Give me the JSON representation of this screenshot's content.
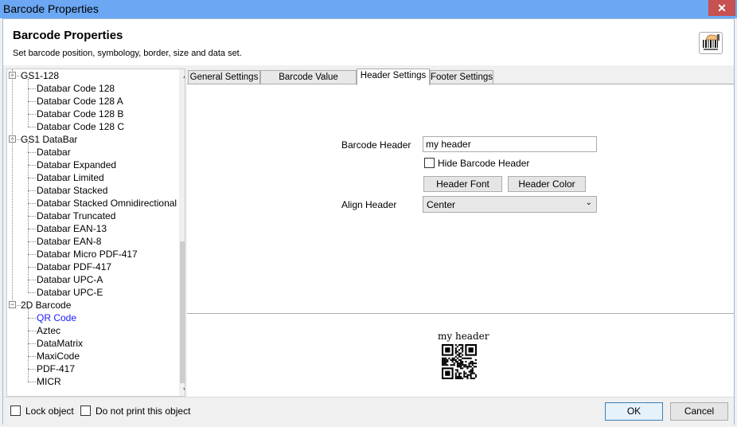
{
  "window": {
    "title": "Barcode Properties",
    "close": "✕"
  },
  "header": {
    "title": "Barcode Properties",
    "subtitle": "Set barcode position, symbology, border, size and data set."
  },
  "tree": [
    {
      "label": "GS1-128",
      "level": 0,
      "expanded": true
    },
    {
      "label": "Databar Code 128",
      "level": 1
    },
    {
      "label": "Databar Code 128 A",
      "level": 1
    },
    {
      "label": "Databar Code 128 B",
      "level": 1
    },
    {
      "label": "Databar Code 128 C",
      "level": 1
    },
    {
      "label": "GS1 DataBar",
      "level": 0,
      "expanded": true
    },
    {
      "label": "Databar",
      "level": 1
    },
    {
      "label": "Databar Expanded",
      "level": 1
    },
    {
      "label": "Databar Limited",
      "level": 1
    },
    {
      "label": "Databar Stacked",
      "level": 1
    },
    {
      "label": "Databar Stacked Omnidirectional",
      "level": 1
    },
    {
      "label": "Databar Truncated",
      "level": 1
    },
    {
      "label": "Databar EAN-13",
      "level": 1
    },
    {
      "label": "Databar EAN-8",
      "level": 1
    },
    {
      "label": "Databar Micro PDF-417",
      "level": 1
    },
    {
      "label": "Databar PDF-417",
      "level": 1
    },
    {
      "label": "Databar UPC-A",
      "level": 1
    },
    {
      "label": "Databar UPC-E",
      "level": 1
    },
    {
      "label": "2D Barcode",
      "level": 0,
      "expanded": true
    },
    {
      "label": "QR Code",
      "level": 1,
      "selected": true
    },
    {
      "label": "Aztec",
      "level": 1
    },
    {
      "label": "DataMatrix",
      "level": 1
    },
    {
      "label": "MaxiCode",
      "level": 1
    },
    {
      "label": "PDF-417",
      "level": 1
    },
    {
      "label": "MICR",
      "level": 1
    }
  ],
  "tabs": [
    "General Settings",
    "Barcode Value Settings",
    "Header Settings",
    "Footer Settings"
  ],
  "active_tab": 2,
  "form": {
    "barcode_header_label": "Barcode Header",
    "barcode_header_value": "my header",
    "hide_header_label": "Hide Barcode Header",
    "hide_header_checked": false,
    "header_font_button": "Header Font",
    "header_color_button": "Header Color",
    "align_header_label": "Align Header",
    "align_header_value": "Center"
  },
  "preview": {
    "header_text": "my header"
  },
  "footer": {
    "lock_label": "Lock object",
    "no_print_label": "Do not print this object",
    "ok": "OK",
    "cancel": "Cancel"
  },
  "colors": {
    "titlebar": "#6ba7f2",
    "close": "#c75050",
    "selected": "#1a1aff"
  }
}
